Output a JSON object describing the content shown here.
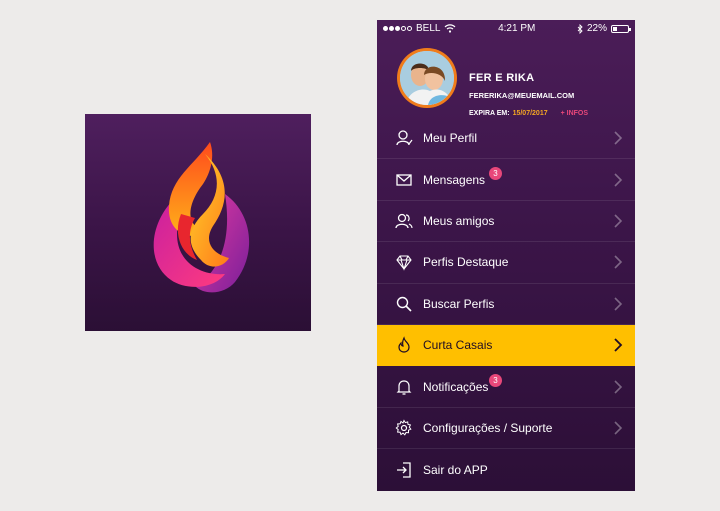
{
  "status_bar": {
    "carrier": "BELL",
    "time": "4:21 PM",
    "battery": "22%",
    "battery_level": 0.22
  },
  "profile": {
    "name": "FER E RIKA",
    "email": "FERERIKA@MEUEMAIL.COM",
    "expires_label": "EXPIRA EM:",
    "expires_date": "15/07/2017",
    "infos_link": "+ INFOS"
  },
  "menu": [
    {
      "label": "Meu Perfil",
      "icon": "user-icon"
    },
    {
      "label": "Mensagens",
      "icon": "envelope-icon",
      "badge": "3"
    },
    {
      "label": "Meus amigos",
      "icon": "friends-icon"
    },
    {
      "label": "Perfis Destaque",
      "icon": "diamond-icon"
    },
    {
      "label": "Buscar Perfis",
      "icon": "search-icon"
    },
    {
      "label": "Curta Casais",
      "icon": "flame-icon",
      "active": true
    },
    {
      "label": "Notificações",
      "icon": "bell-icon",
      "badge": "3"
    },
    {
      "label": "Configurações / Suporte",
      "icon": "gear-icon"
    },
    {
      "label": "Sair do APP",
      "icon": "logout-icon"
    }
  ],
  "colors": {
    "accent": "#ffbf00",
    "badge": "#e8477a",
    "expiry_date": "#f5a623",
    "background_dark": "#2c0f37",
    "background_top": "#4b1d58"
  }
}
